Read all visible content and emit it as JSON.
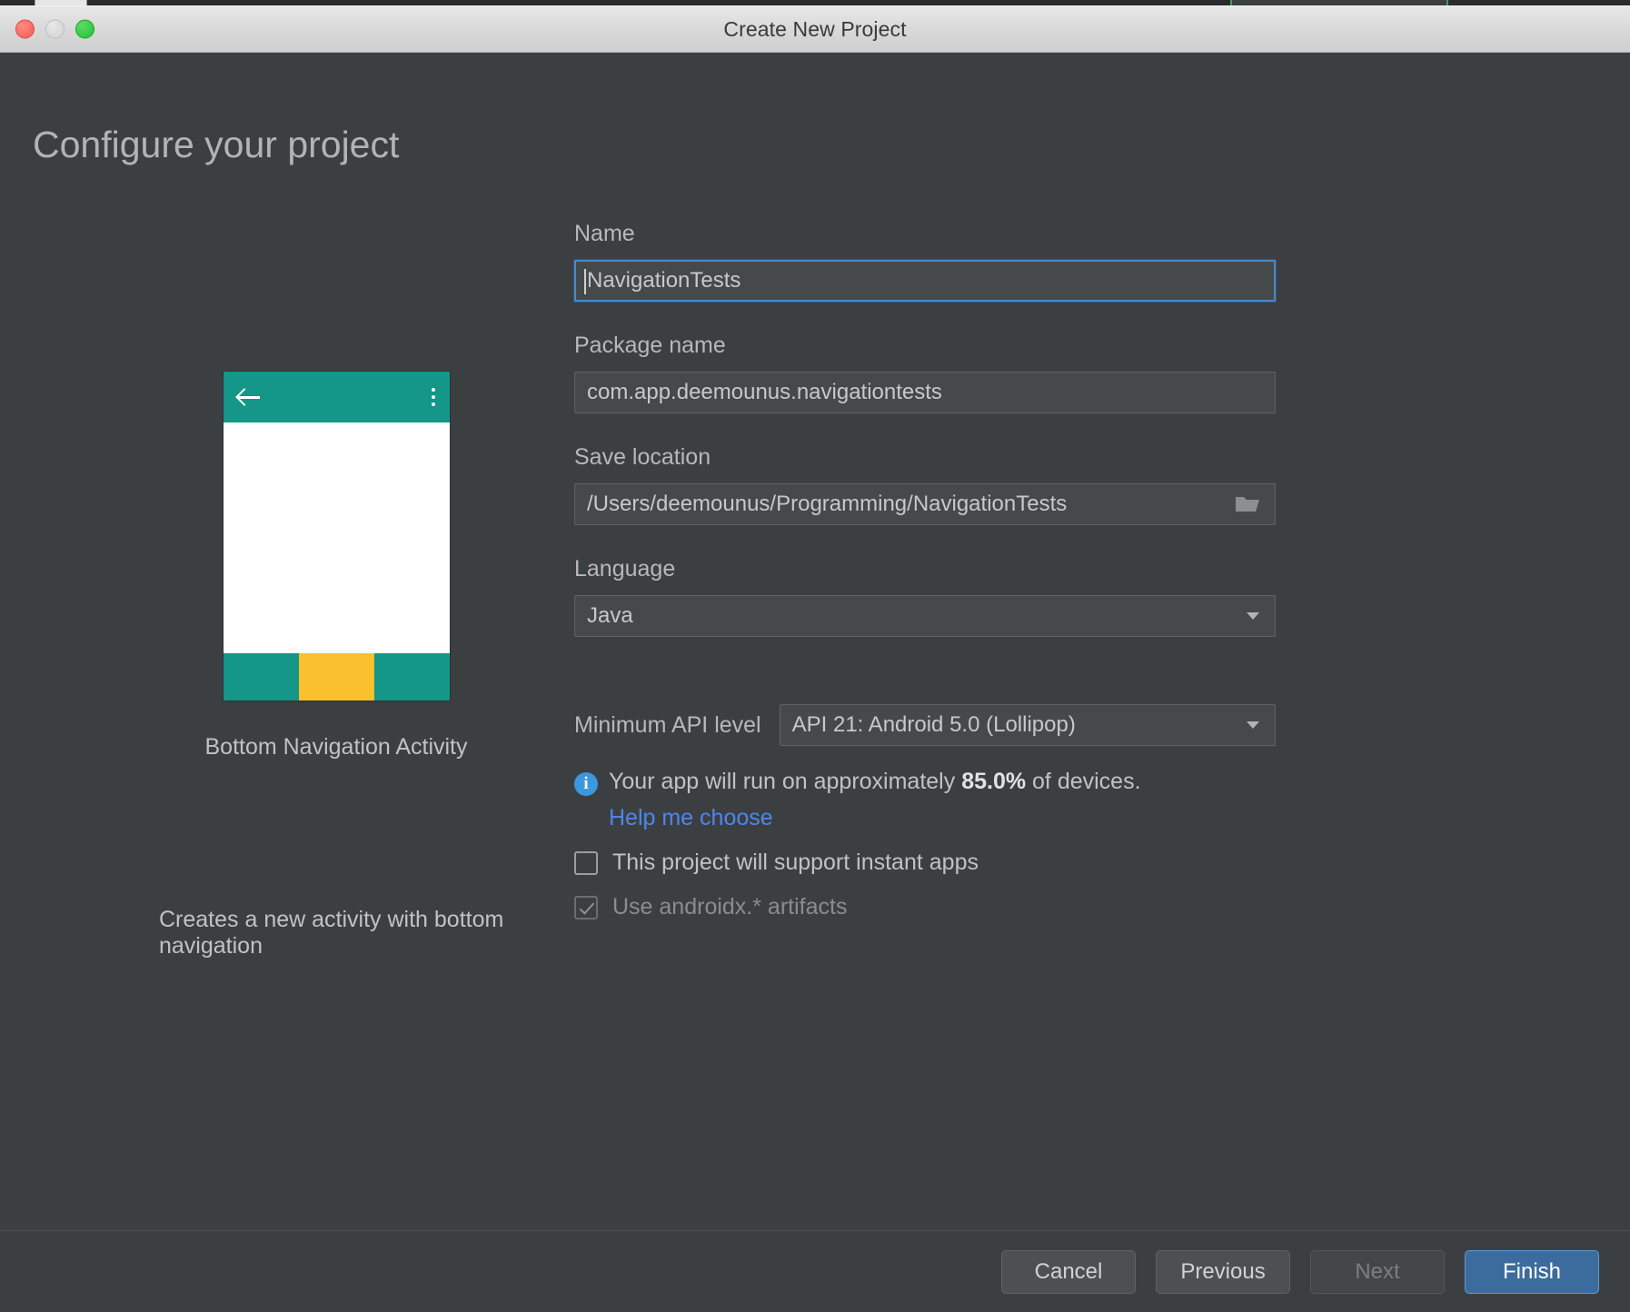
{
  "window": {
    "title": "Create New Project",
    "traffic_lights": [
      "close",
      "minimize",
      "zoom"
    ]
  },
  "page": {
    "title": "Configure your project"
  },
  "preview": {
    "template_name": "Bottom Navigation Activity",
    "description": "Creates a new activity with bottom navigation",
    "accent_color": "#149688",
    "highlight_color": "#fbc02d",
    "back_icon": "back-arrow-icon",
    "overflow_icon": "kebab-menu-icon"
  },
  "form": {
    "name": {
      "label": "Name",
      "value": "NavigationTests",
      "focused": true
    },
    "package_name": {
      "label": "Package name",
      "value": "com.app.deemounus.navigationtests"
    },
    "save_location": {
      "label": "Save location",
      "value": "/Users/deemounus/Programming/NavigationTests",
      "browse_icon": "folder-icon"
    },
    "language": {
      "label": "Language",
      "value": "Java",
      "dropdown_icon": "chevron-down-icon"
    },
    "min_api": {
      "label": "Minimum API level",
      "value": "API 21: Android 5.0 (Lollipop)",
      "dropdown_icon": "chevron-down-icon"
    },
    "device_info": {
      "icon": "info-icon",
      "prefix": "Your app will run on approximately ",
      "percent": "85.0%",
      "suffix": " of devices.",
      "link": "Help me choose",
      "link_color": "#4d86ec",
      "icon_color": "#3c97dd"
    },
    "instant_apps": {
      "label": "This project will support instant apps",
      "checked": false,
      "disabled": false
    },
    "androidx": {
      "label": "Use androidx.* artifacts",
      "checked": true,
      "disabled": true
    }
  },
  "footer": {
    "cancel": "Cancel",
    "previous": "Previous",
    "next": "Next",
    "finish": "Finish",
    "next_disabled": true,
    "finish_color": "#3c6c9d"
  }
}
